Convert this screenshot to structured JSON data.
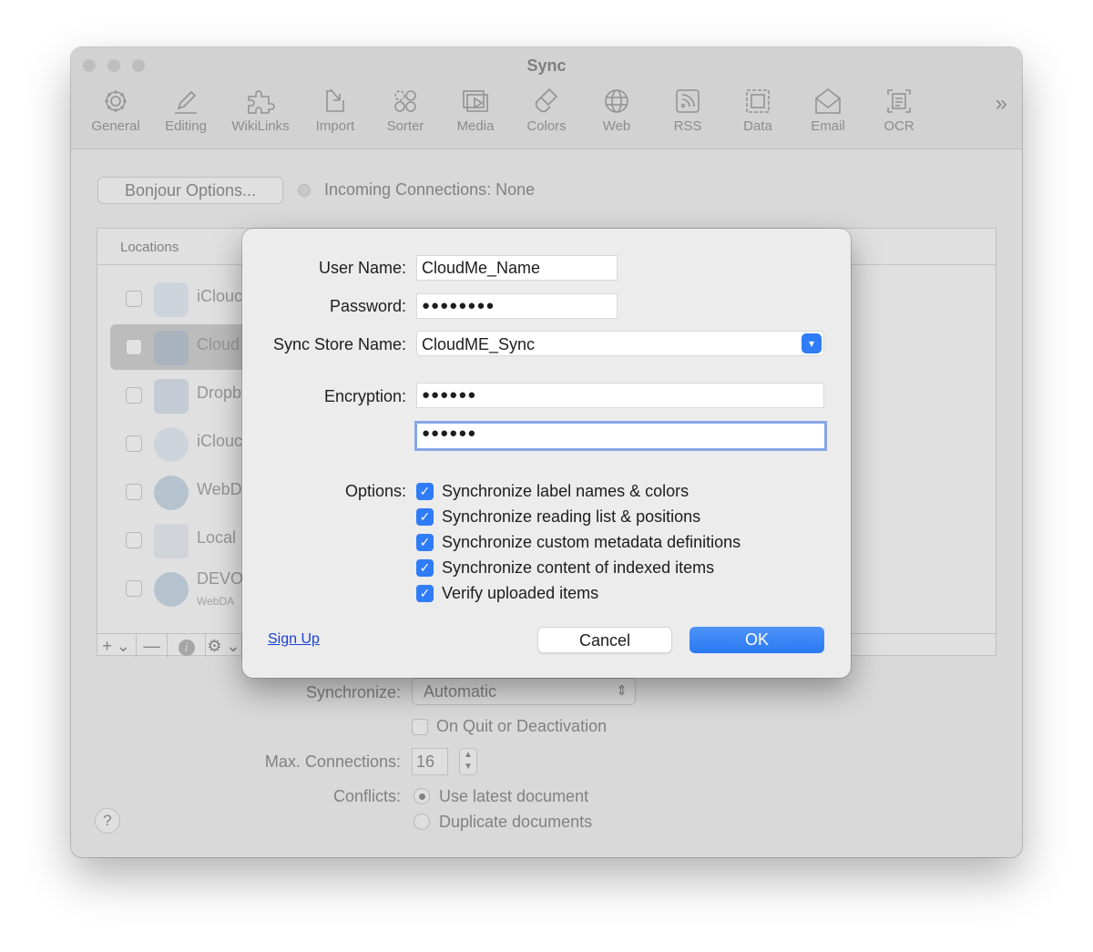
{
  "window": {
    "title": "Sync"
  },
  "toolbar": {
    "items": [
      {
        "label": "General",
        "icon": "gear-icon"
      },
      {
        "label": "Editing",
        "icon": "pencil-icon"
      },
      {
        "label": "WikiLinks",
        "icon": "puzzle-icon"
      },
      {
        "label": "Import",
        "icon": "import-icon"
      },
      {
        "label": "Sorter",
        "icon": "sorter-icon"
      },
      {
        "label": "Media",
        "icon": "media-icon"
      },
      {
        "label": "Colors",
        "icon": "brush-icon"
      },
      {
        "label": "Web",
        "icon": "globe-icon"
      },
      {
        "label": "RSS",
        "icon": "rss-icon"
      },
      {
        "label": "Data",
        "icon": "data-icon"
      },
      {
        "label": "Email",
        "icon": "envelope-icon"
      },
      {
        "label": "OCR",
        "icon": "ocr-icon"
      }
    ],
    "more": "»"
  },
  "background": {
    "bonjour_button": "Bonjour Options...",
    "incoming_connections": "Incoming Connections: None",
    "locations_header": "Locations",
    "locations": [
      {
        "label": "iClouc",
        "sub": "",
        "selected": false
      },
      {
        "label": "Cloud",
        "sub": "",
        "selected": true
      },
      {
        "label": "Dropb",
        "sub": "",
        "selected": false
      },
      {
        "label": "iClouc",
        "sub": "",
        "selected": false
      },
      {
        "label": "WebD",
        "sub": "",
        "selected": false
      },
      {
        "label": "Local",
        "sub": "",
        "selected": false
      },
      {
        "label": "DEVO",
        "sub": "WebDA",
        "selected": false
      }
    ],
    "bottom_bar": {
      "add": "+ ⌄",
      "remove": "—",
      "info": "i",
      "action": "⚙ ⌄"
    },
    "synchronize_label": "Synchronize:",
    "synchronize_value": "Automatic",
    "on_quit_label": "On Quit or Deactivation",
    "max_connections_label": "Max. Connections:",
    "max_connections_value": "16",
    "conflicts_label": "Conflicts:",
    "conflict_options": [
      "Use latest document",
      "Duplicate documents"
    ],
    "conflict_selected": "Use latest document",
    "help": "?"
  },
  "sheet": {
    "user_name_label": "User Name:",
    "user_name_value": "CloudMe_Name",
    "password_label": "Password:",
    "password_value": "●●●●●●●●",
    "sync_store_label": "Sync Store Name:",
    "sync_store_value": "CloudME_Sync",
    "encryption_label": "Encryption:",
    "encryption_value": "●●●●●●",
    "encryption_confirm_value": "●●●●●●",
    "options_label": "Options:",
    "options": [
      {
        "label": "Synchronize label names & colors",
        "checked": true
      },
      {
        "label": "Synchronize reading list & positions",
        "checked": true
      },
      {
        "label": "Synchronize custom metadata definitions",
        "checked": true
      },
      {
        "label": "Synchronize content of indexed items",
        "checked": true
      },
      {
        "label": "Verify uploaded items",
        "checked": true
      }
    ],
    "sign_up": "Sign Up",
    "cancel": "Cancel",
    "ok": "OK"
  },
  "colors": {
    "accent": "#2f7cf6",
    "link": "#1a40d8"
  }
}
